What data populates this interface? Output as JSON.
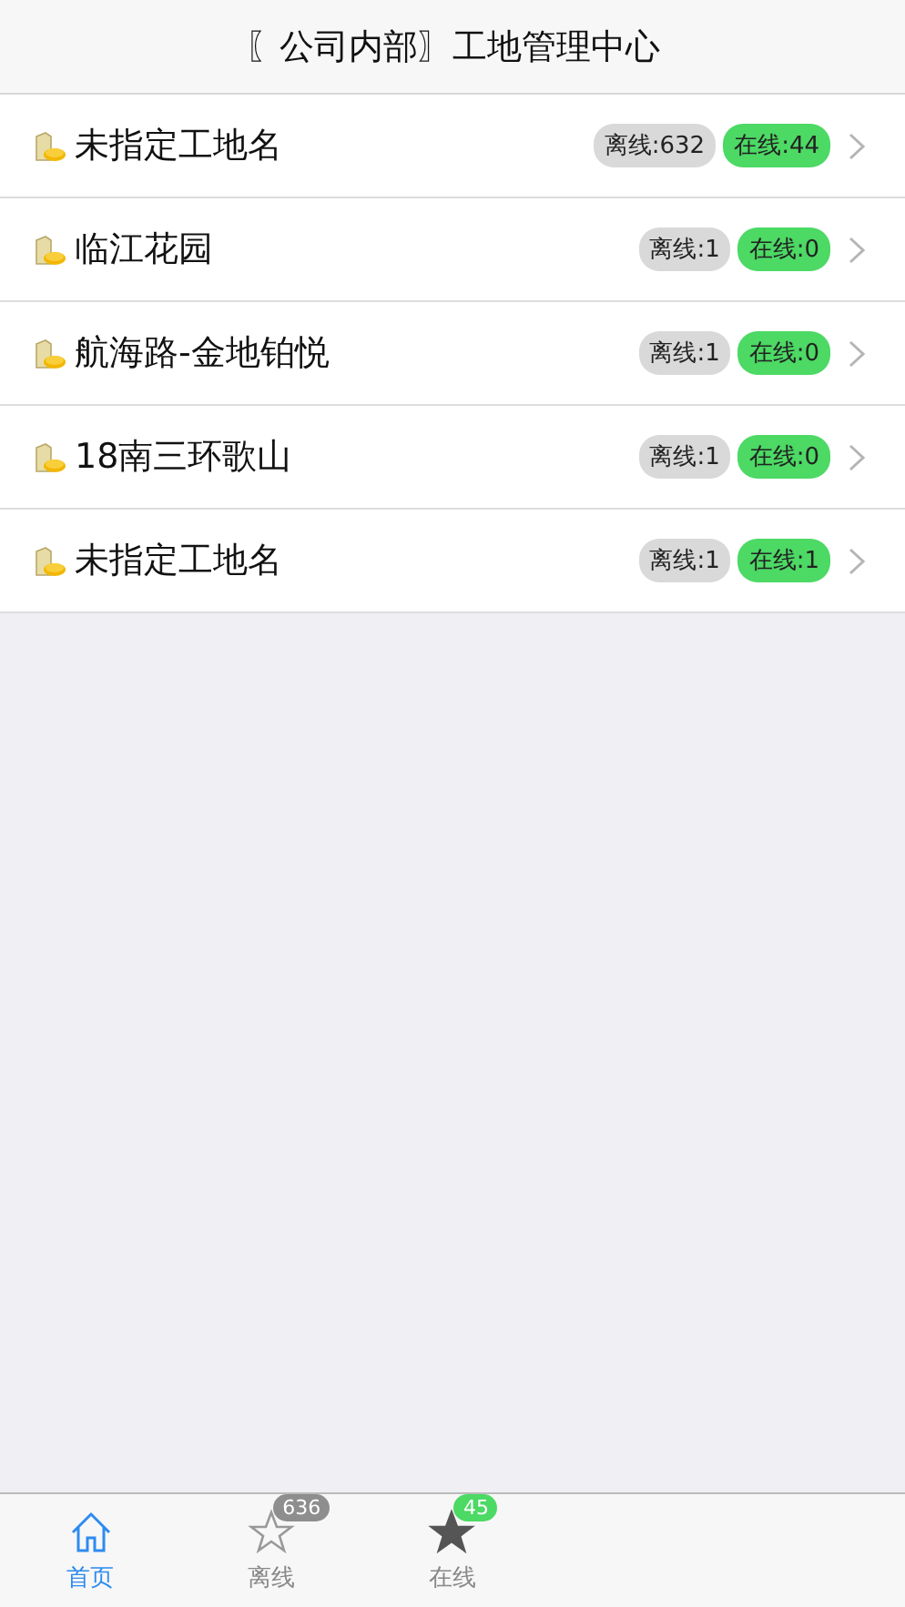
{
  "header": {
    "title": "〖公司内部〗工地管理中心"
  },
  "sites": [
    {
      "name": "未指定工地名",
      "offline": "离线:632",
      "online": "在线:44"
    },
    {
      "name": "临江花园",
      "offline": "离线:1",
      "online": "在线:0"
    },
    {
      "name": "航海路-金地铂悦",
      "offline": "离线:1",
      "online": "在线:0"
    },
    {
      "name": "18南三环歌山",
      "offline": "离线:1",
      "online": "在线:0"
    },
    {
      "name": "未指定工地名",
      "offline": "离线:1",
      "online": "在线:1"
    }
  ],
  "tabs": [
    {
      "label": "首页",
      "kind": "home",
      "selected": true
    },
    {
      "label": "离线",
      "kind": "offline",
      "selected": false,
      "badge": "636"
    },
    {
      "label": "在线",
      "kind": "online",
      "selected": false,
      "badge": "45"
    }
  ]
}
